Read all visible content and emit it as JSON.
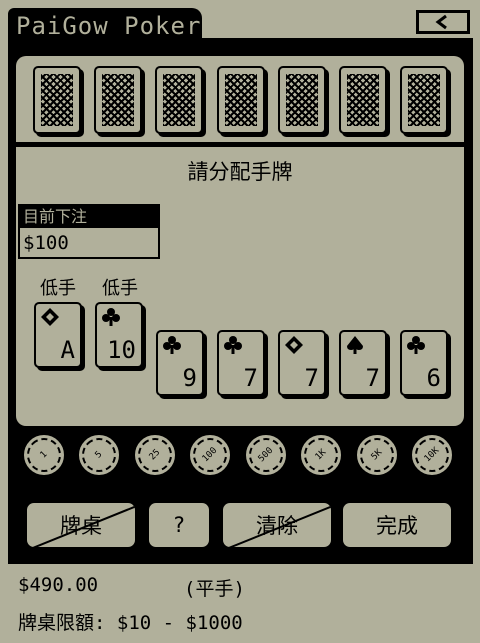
{
  "app": {
    "title": "PaiGow Poker"
  },
  "prompt": "請分配手牌",
  "bet": {
    "label": "目前下注",
    "value": "$100"
  },
  "hand_labels": {
    "low_a": "低手",
    "low_b": "低手"
  },
  "dealer_cards": [
    {
      "icon": "card-back"
    },
    {
      "icon": "card-back"
    },
    {
      "icon": "card-back"
    },
    {
      "icon": "card-back"
    },
    {
      "icon": "card-back"
    },
    {
      "icon": "card-back"
    },
    {
      "icon": "card-back"
    }
  ],
  "low_hand": [
    {
      "rank": "A",
      "suit": "diamond"
    },
    {
      "rank": "10",
      "suit": "club"
    }
  ],
  "high_hand": [
    {
      "rank": "9",
      "suit": "club"
    },
    {
      "rank": "7",
      "suit": "club"
    },
    {
      "rank": "7",
      "suit": "diamond"
    },
    {
      "rank": "7",
      "suit": "spade"
    },
    {
      "rank": "6",
      "suit": "club"
    }
  ],
  "chips": [
    "1",
    "5",
    "25",
    "100",
    "500",
    "1K",
    "5K",
    "10K"
  ],
  "actions": {
    "table": "牌桌",
    "help": "?",
    "clear": "清除",
    "done": "完成"
  },
  "status": {
    "balance": "$490.00",
    "result": "(平手)"
  },
  "limits": "牌桌限額: $10 - $1000",
  "colors": {
    "background": "#b1b09b",
    "ink": "#000000"
  }
}
